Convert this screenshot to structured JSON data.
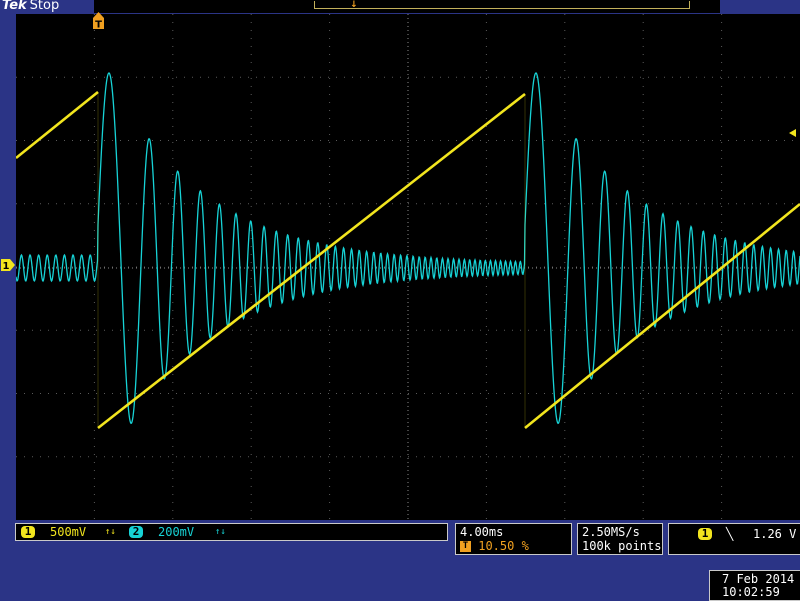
{
  "header": {
    "brand": "Tek",
    "run_state": "Stop"
  },
  "markers": {
    "trigger_position": "T",
    "ch1_ground": "1"
  },
  "channels": [
    {
      "badge": "1",
      "scale": "500mV",
      "coupling_icon": "bandwidth-icon",
      "color": "#f2e51e"
    },
    {
      "badge": "2",
      "scale": "200mV",
      "coupling_icon": "bandwidth-icon",
      "color": "#17d3d6"
    }
  ],
  "timebase": {
    "horizontal_scale": "4.00ms",
    "trigger_marker": "T",
    "trigger_position": "10.50 %"
  },
  "acquisition": {
    "sample_rate": "2.50MS/s",
    "record_length": "100k points"
  },
  "trigger": {
    "source": "1",
    "slope_icon": "falling-edge-icon",
    "level": "1.26 V"
  },
  "datetime": {
    "date": "7 Feb  2014",
    "time": "10:02:59"
  },
  "colors": {
    "ch1": "#f2e51e",
    "ch2": "#17d3d6",
    "trigger": "#f0a020",
    "background": "#2b3486"
  }
}
